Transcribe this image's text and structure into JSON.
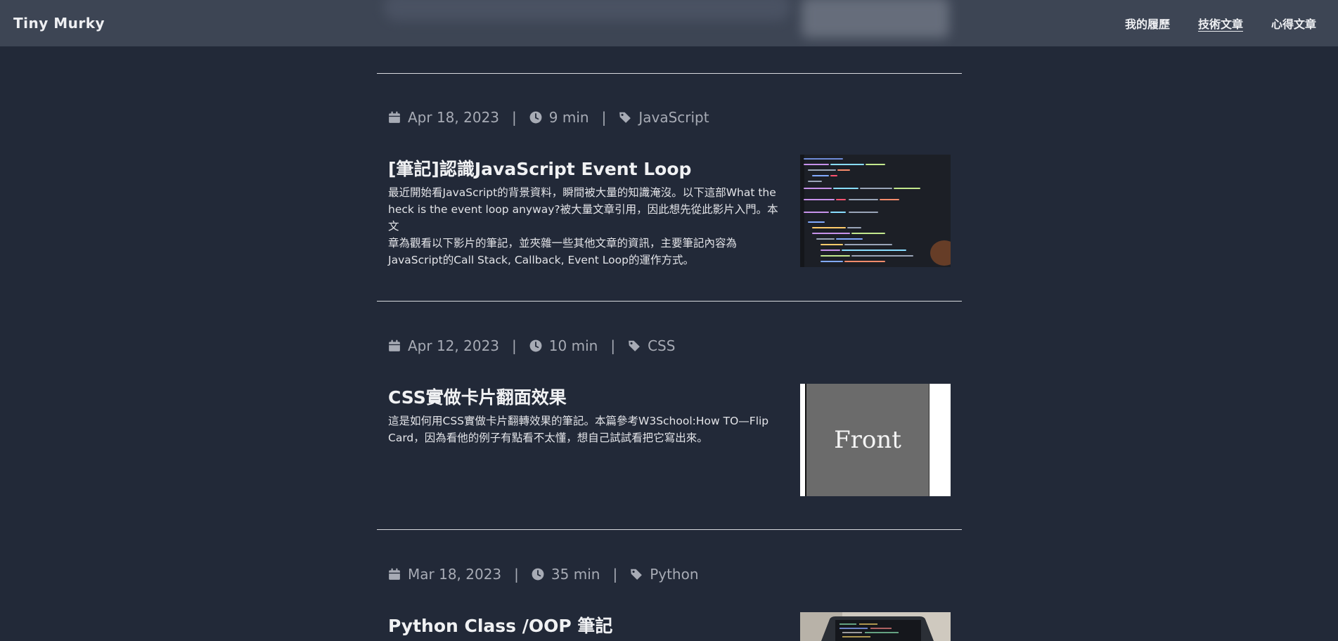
{
  "brand": "Tiny Murky",
  "nav": {
    "resume": "我的履歷",
    "tech": "技術文章",
    "thoughts": "心得文章"
  },
  "posts": [
    {
      "date": "Apr 18, 2023",
      "read_time": "9 min",
      "tag": "JavaScript",
      "title": "[筆記]認識JavaScript Event Loop",
      "excerpt_lines": [
        "最近開始看JavaScript的背景資料，瞬間被大量的知識淹沒。以下這部What the",
        "heck is the event loop anyway?被大量文章引用，因此想先從此影片入門。本文",
        "章為觀看以下影片的筆記，並夾雜一些其他文章的資訊，主要筆記內容為",
        "JavaScript的Call Stack, Callback, Event Loop的運作方式。"
      ]
    },
    {
      "date": "Apr 12, 2023",
      "read_time": "10 min",
      "tag": "CSS",
      "title": "CSS實做卡片翻面效果",
      "excerpt_lines": [
        "這是如何用CSS實做卡片翻轉效果的筆記。本篇參考W3School:How TO—Flip",
        "Card，因為看他的例子有點看不太懂，想自己試試看把它寫出來。"
      ],
      "thumb_text": "Front"
    },
    {
      "date": "Mar 18, 2023",
      "read_time": "35 min",
      "tag": "Python",
      "title": "Python Class /OOP 筆記"
    }
  ],
  "separator": "|",
  "icons": [
    "calendar-icon",
    "clock-icon",
    "tag-icon"
  ],
  "colors": {
    "background": "#222938",
    "navbar": "#3e4656",
    "text": "#e8e9ec",
    "meta": "#a7abb5"
  }
}
